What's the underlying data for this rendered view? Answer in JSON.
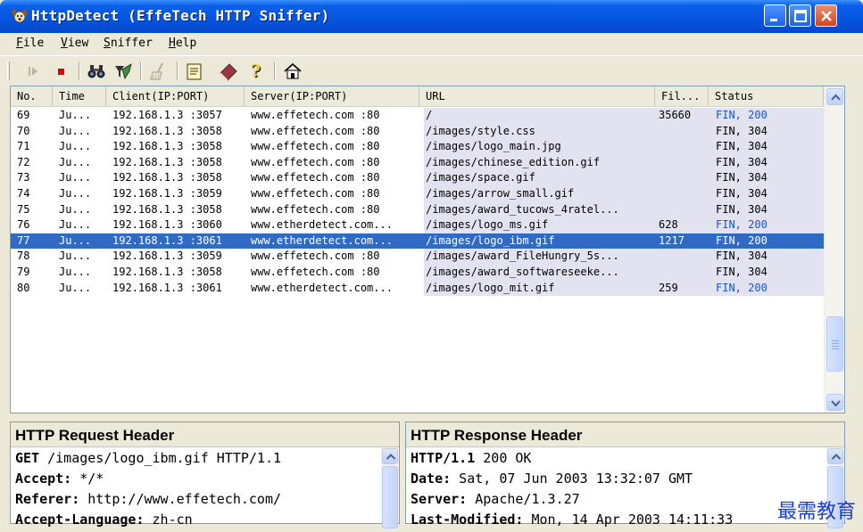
{
  "window": {
    "title": "HttpDetect (EffeTech HTTP Sniffer)",
    "app_icon": "dog-face-icon",
    "controls": [
      "minimize-icon",
      "maximize-icon",
      "close-icon"
    ]
  },
  "menu": [
    {
      "label": "File",
      "underline": "F",
      "rest": "ile"
    },
    {
      "label": "View",
      "underline": "V",
      "rest": "iew"
    },
    {
      "label": "Sniffer",
      "underline": "S",
      "rest": "niffer"
    },
    {
      "label": "Help",
      "underline": "H",
      "rest": "elp"
    }
  ],
  "toolbar": {
    "icons": [
      "start-icon",
      "stop-icon",
      "find-binoculars-icon",
      "filter-icon",
      "clear-broom-icon",
      "notes-icon",
      "erase-icon",
      "help-question-icon",
      "home-icon"
    ]
  },
  "list": {
    "columns": [
      "No.",
      "Time",
      "Client(IP:PORT)",
      "Server(IP:PORT)",
      "URL",
      "Fil...",
      "Status"
    ],
    "selected_index": 8,
    "rows": [
      {
        "no": "69",
        "time": "Ju...",
        "client": "192.168.1.3 :3057",
        "server": "www.effetech.com :80",
        "url": "/",
        "file": "35660",
        "status": "FIN, 200"
      },
      {
        "no": "70",
        "time": "Ju...",
        "client": "192.168.1.3 :3058",
        "server": "www.effetech.com :80",
        "url": "/images/style.css",
        "file": "",
        "status": "FIN, 304"
      },
      {
        "no": "71",
        "time": "Ju...",
        "client": "192.168.1.3 :3058",
        "server": "www.effetech.com :80",
        "url": "/images/logo_main.jpg",
        "file": "",
        "status": "FIN, 304"
      },
      {
        "no": "72",
        "time": "Ju...",
        "client": "192.168.1.3 :3058",
        "server": "www.effetech.com :80",
        "url": "/images/chinese_edition.gif",
        "file": "",
        "status": "FIN, 304"
      },
      {
        "no": "73",
        "time": "Ju...",
        "client": "192.168.1.3 :3058",
        "server": "www.effetech.com :80",
        "url": "/images/space.gif",
        "file": "",
        "status": "FIN, 304"
      },
      {
        "no": "74",
        "time": "Ju...",
        "client": "192.168.1.3 :3059",
        "server": "www.effetech.com :80",
        "url": "/images/arrow_small.gif",
        "file": "",
        "status": "FIN, 304"
      },
      {
        "no": "75",
        "time": "Ju...",
        "client": "192.168.1.3 :3058",
        "server": "www.effetech.com :80",
        "url": "/images/award_tucows_4ratel...",
        "file": "",
        "status": "FIN, 304"
      },
      {
        "no": "76",
        "time": "Ju...",
        "client": "192.168.1.3 :3060",
        "server": "www.etherdetect.com...",
        "url": "/images/logo_ms.gif",
        "file": "628",
        "status": "FIN, 200"
      },
      {
        "no": "77",
        "time": "Ju...",
        "client": "192.168.1.3 :3061",
        "server": "www.etherdetect.com...",
        "url": "/images/logo_ibm.gif",
        "file": "1217",
        "status": "FIN, 200"
      },
      {
        "no": "78",
        "time": "Ju...",
        "client": "192.168.1.3 :3059",
        "server": "www.effetech.com :80",
        "url": "/images/award_FileHungry_5s...",
        "file": "",
        "status": "FIN, 304"
      },
      {
        "no": "79",
        "time": "Ju...",
        "client": "192.168.1.3 :3058",
        "server": "www.effetech.com :80",
        "url": "/images/award_softwareseeke...",
        "file": "",
        "status": "FIN, 304"
      },
      {
        "no": "80",
        "time": "Ju...",
        "client": "192.168.1.3 :3061",
        "server": "www.etherdetect.com...",
        "url": "/images/logo_mit.gif",
        "file": "259",
        "status": "FIN, 200"
      }
    ]
  },
  "request_panel": {
    "title": "HTTP Request Header",
    "lines": [
      {
        "key": "GET",
        "value": " /images/logo_ibm.gif HTTP/1.1"
      },
      {
        "key": "Accept:",
        "value": " */*"
      },
      {
        "key": "Referer:",
        "value": " http://www.effetech.com/"
      },
      {
        "key": "Accept-Language:",
        "value": " zh-cn"
      }
    ]
  },
  "response_panel": {
    "title": "HTTP Response Header",
    "lines": [
      {
        "key": "HTTP/1.1",
        "value": " 200 OK"
      },
      {
        "key": "Date:",
        "value": " Sat, 07 Jun 2003 13:32:07 GMT"
      },
      {
        "key": "Server:",
        "value": " Apache/1.3.27"
      },
      {
        "key": "Last-Modified:",
        "value": " Mon, 14 Apr 2003 14:11:33"
      }
    ]
  },
  "watermark": "最需教育",
  "colors": {
    "selection": "#316ac5",
    "status_200": "#1a56c2",
    "titlebar": "#0554e0"
  }
}
